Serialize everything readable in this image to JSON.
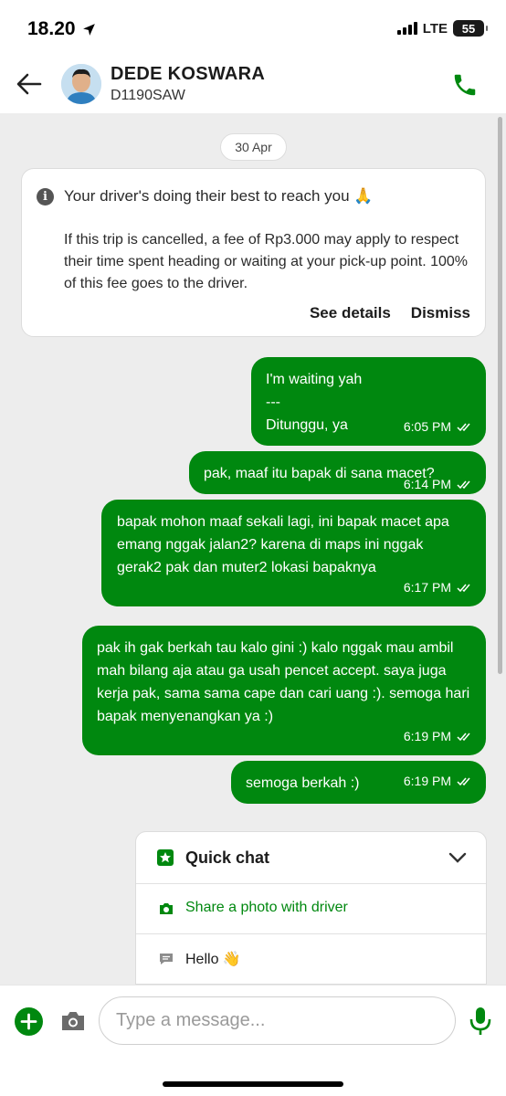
{
  "status_bar": {
    "time": "18.20",
    "network": "LTE",
    "battery": "55"
  },
  "header": {
    "driver_name": "DEDE KOSWARA",
    "plate": "D1190SAW",
    "back_icon": "arrow-left-icon",
    "call_icon": "phone-icon",
    "brand_color": "#00880f"
  },
  "chat": {
    "date_chip": "30 Apr",
    "notice": {
      "title": "Your driver's doing their best to reach you 🙏",
      "body": "If this trip is cancelled, a fee of Rp3.000 may apply to respect their time spent heading or waiting at your pick-up point. 100% of this fee goes to the driver.",
      "see_details": "See details",
      "dismiss": "Dismiss"
    },
    "messages": [
      {
        "text": "I'm waiting yah\n---\nDitunggu, ya",
        "time": "6:05 PM",
        "status": "read"
      },
      {
        "text": "pak, maaf itu bapak di sana macet?",
        "time": "6:14 PM",
        "status": "read"
      },
      {
        "text": "bapak mohon maaf sekali lagi, ini bapak macet apa emang nggak jalan2? karena di maps ini nggak gerak2 pak dan muter2 lokasi bapaknya",
        "time": "6:17 PM",
        "status": "read"
      },
      {
        "text": "pak ih gak berkah tau kalo gini :) kalo nggak mau ambil mah bilang aja atau ga usah pencet accept. saya juga kerja pak, sama sama cape dan cari uang :). semoga hari bapak menyenangkan ya :)",
        "time": "6:19 PM",
        "status": "read"
      },
      {
        "text": "semoga berkah :)",
        "time": "6:19 PM",
        "status": "read"
      }
    ]
  },
  "quick_chat": {
    "title": "Quick chat",
    "items": [
      {
        "label": "Share a photo with driver",
        "icon": "camera-icon",
        "color": "#00880f"
      },
      {
        "label": "Hello 👋",
        "icon": "chat-bubble-icon",
        "color": "#1c1c1c"
      }
    ]
  },
  "composer": {
    "placeholder": "Type a message..."
  }
}
